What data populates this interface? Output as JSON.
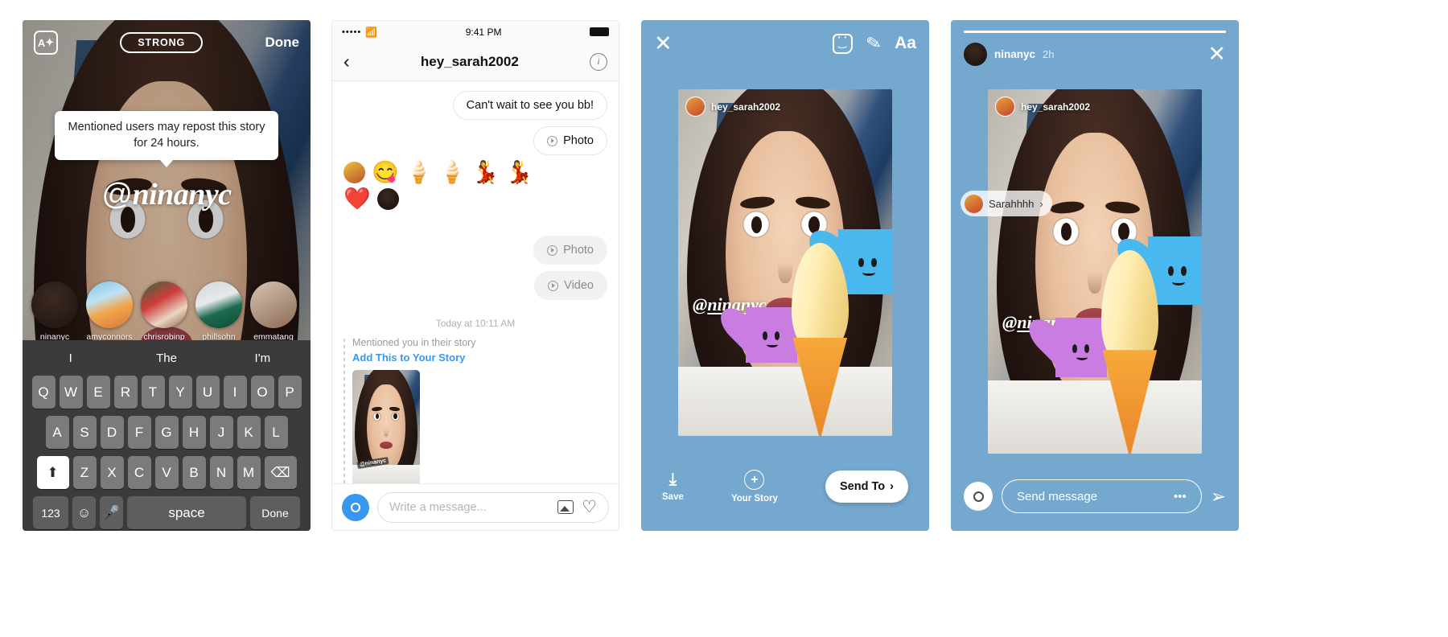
{
  "panel1": {
    "name": "story-mention-editor",
    "toolbar": {
      "text_style_icon": "text-format-icon",
      "text_style_label": "A",
      "strength_label": "STRONG",
      "done_label": "Done"
    },
    "tooltip": "Mentioned users may repost this story for 24 hours.",
    "mention": {
      "at": "@",
      "handle": "ninanyc"
    },
    "suggestions": [
      {
        "username": "ninanyc"
      },
      {
        "username": "amyconnors"
      },
      {
        "username": "chrisrobinp"
      },
      {
        "username": "phillsohn"
      },
      {
        "username": "emmatang"
      }
    ],
    "keyboard": {
      "predictions": [
        "I",
        "The",
        "I'm"
      ],
      "row1": [
        "Q",
        "W",
        "E",
        "R",
        "T",
        "Y",
        "U",
        "I",
        "O",
        "P"
      ],
      "row2": [
        "A",
        "S",
        "D",
        "F",
        "G",
        "H",
        "J",
        "K",
        "L"
      ],
      "row3": [
        "Z",
        "X",
        "C",
        "V",
        "B",
        "N",
        "M"
      ],
      "shift_icon": "shift-up-icon",
      "backspace_icon": "backspace-icon",
      "num_label": "123",
      "emoji_icon": "emoji-icon",
      "mic_icon": "microphone-icon",
      "space_label": "space",
      "done_label": "Done"
    }
  },
  "panel2": {
    "name": "direct-message-thread",
    "statusbar": {
      "signal": "•••••",
      "wifi_icon": "wifi-icon",
      "time": "9:41 PM",
      "battery_icon": "battery-full-icon"
    },
    "navbar": {
      "back_icon": "chevron-left-icon",
      "title": "hey_sarah2002",
      "info_icon": "info-circle-icon"
    },
    "messages": [
      {
        "side": "right",
        "type": "text",
        "text": "Can't wait to see you bb!"
      },
      {
        "side": "right",
        "type": "media",
        "label": "Photo",
        "icon": "play-circle-icon"
      }
    ],
    "reactions_row1": [
      "avatar",
      "😋",
      "🍦",
      "🍦",
      "💃",
      "💃"
    ],
    "reactions_row2": [
      "❤️",
      "avatar"
    ],
    "outgoing": [
      {
        "label": "Photo",
        "icon": "play-circle-icon"
      },
      {
        "label": "Video",
        "icon": "play-circle-icon"
      }
    ],
    "timestamp": "Today at 10:11 AM",
    "mention_block": {
      "label": "Mentioned you in their story",
      "link": "Add This to Your Story",
      "thumb_tag": "@ninanyc"
    },
    "composer": {
      "camera_icon": "camera-icon",
      "placeholder": "Write a message...",
      "gallery_icon": "gallery-icon",
      "heart_icon": "heart-icon"
    }
  },
  "panel3": {
    "name": "story-composer",
    "topbar": {
      "close_icon": "close-icon",
      "sticker_icon": "sticker-icon",
      "draw_icon": "pen-icon",
      "text_icon": "text-aa-icon",
      "text_label": "Aa"
    },
    "story": {
      "author": "hey_sarah2002",
      "mention_at": "@",
      "mention_handle": "ninanyc"
    },
    "bottombar": {
      "save_icon": "download-icon",
      "save_label": "Save",
      "your_story_icon": "plus-circle-icon",
      "your_story_label": "Your Story",
      "send_to_label": "Send To",
      "send_to_icon": "chevron-right-icon"
    },
    "accent_color": "#75a8ce"
  },
  "panel4": {
    "name": "story-viewer",
    "header": {
      "username": "ninanyc",
      "time_ago": "2h",
      "close_icon": "close-icon"
    },
    "reply_chip": {
      "text": "Sarahhhh",
      "chevron_icon": "chevron-right-icon"
    },
    "story": {
      "author": "hey_sarah2002",
      "mention_at": "@",
      "mention_handle": "ninanyc"
    },
    "bottombar": {
      "camera_icon": "camera-icon",
      "placeholder": "Send message",
      "more_icon": "ellipsis-icon",
      "more_label": "•••",
      "send_icon": "send-icon"
    }
  }
}
